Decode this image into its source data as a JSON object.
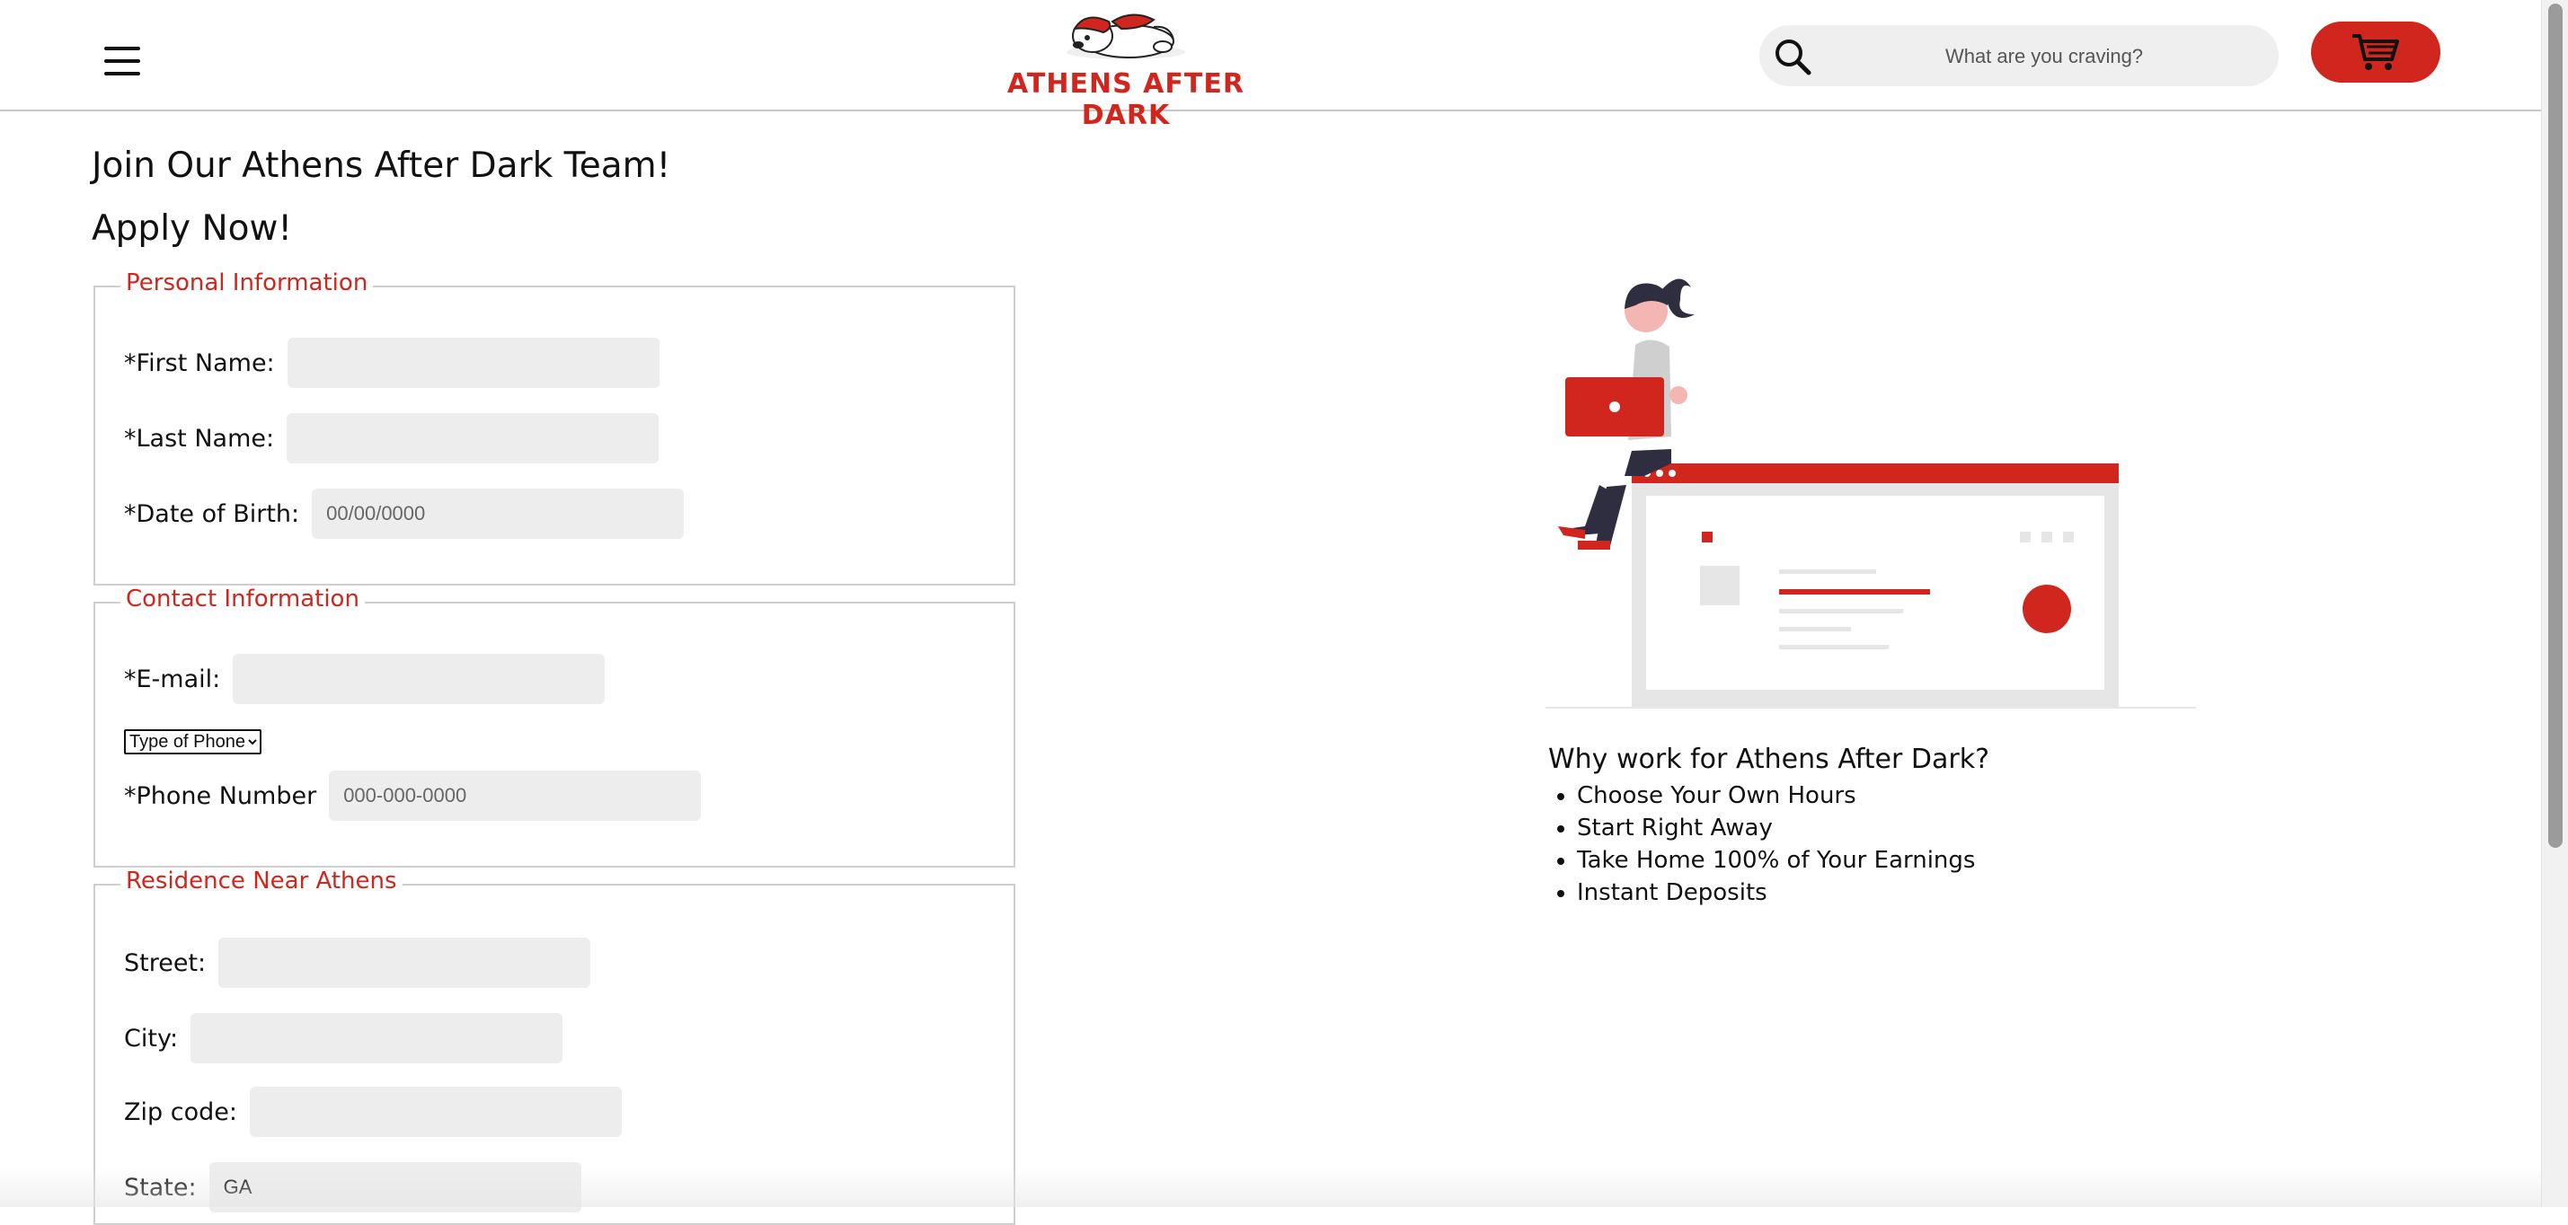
{
  "header": {
    "logo_text": "ATHENS AFTER DARK",
    "search_placeholder": "What are you craving?",
    "menu_icon": "hamburger-menu-icon",
    "search_icon": "magnifier-icon",
    "cart_icon": "shopping-cart-icon",
    "accent_color": "#d0261d"
  },
  "page": {
    "title": "Join Our Athens After Dark Team!",
    "subtitle": "Apply Now!"
  },
  "form": {
    "personal": {
      "legend": "Personal Information",
      "first_name_label": "*First Name:",
      "last_name_label": "*Last Name:",
      "dob_label": "*Date of Birth:",
      "dob_placeholder": "00/00/0000"
    },
    "contact": {
      "legend": "Contact Information",
      "email_label": "*E-mail:",
      "phone_type_selected": "Type of Phone",
      "phone_label": "*Phone Number",
      "phone_placeholder": "000-000-0000"
    },
    "residence": {
      "legend": "Residence Near Athens",
      "street_label": "Street:",
      "city_label": "City:",
      "zip_label": "Zip code:",
      "state_label": "State:",
      "state_value": "GA"
    }
  },
  "why": {
    "title": "Why work for Athens After Dark?",
    "items": [
      "Choose Your Own Hours",
      "Start Right Away",
      "Take Home 100% of Your Earnings",
      "Instant Deposits"
    ]
  }
}
